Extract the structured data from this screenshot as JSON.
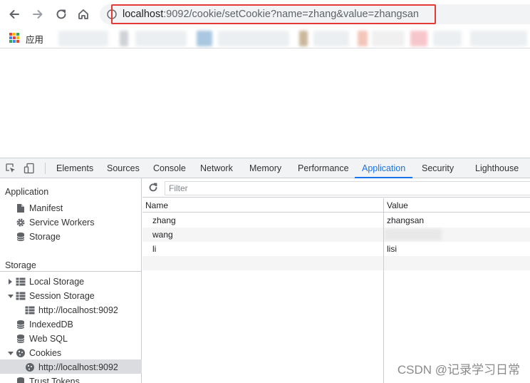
{
  "browser": {
    "url_host": "localhost",
    "url_path": ":9092/cookie/setCookie?name=zhang&value=zhangsan",
    "apps_label": "应用"
  },
  "devtools": {
    "tabs": [
      "Elements",
      "Sources",
      "Console",
      "Network",
      "Memory",
      "Performance",
      "Application",
      "Security",
      "Lighthouse"
    ],
    "active_tab": "Application",
    "sidebar": {
      "application_title": "Application",
      "application_items": [
        "Manifest",
        "Service Workers",
        "Storage"
      ],
      "storage_title": "Storage",
      "storage_items": {
        "local_storage": "Local Storage",
        "session_storage": "Session Storage",
        "session_child": "http://localhost:9092",
        "indexeddb": "IndexedDB",
        "websql": "Web SQL",
        "cookies": "Cookies",
        "cookies_child": "http://localhost:9092",
        "trust_tokens": "Trust Tokens"
      }
    },
    "filter_placeholder": "Filter",
    "table": {
      "columns": [
        "Name",
        "Value"
      ],
      "rows": [
        {
          "name": "zhang",
          "value": "zhangsan"
        },
        {
          "name": "wang",
          "value": ""
        },
        {
          "name": "li",
          "value": "lisi"
        }
      ]
    }
  },
  "watermark": "CSDN @记录学习日常"
}
